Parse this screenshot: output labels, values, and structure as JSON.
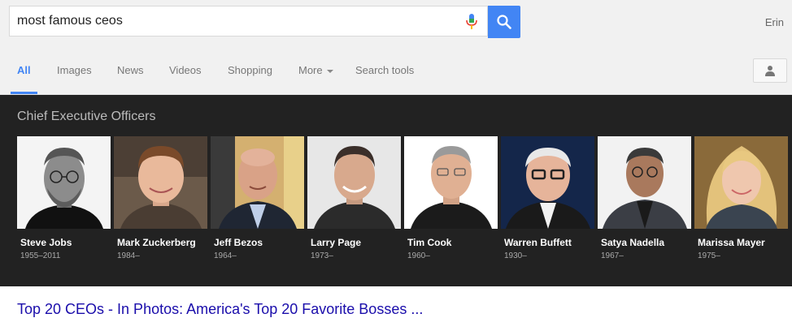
{
  "search": {
    "query": "most famous ceos"
  },
  "user": {
    "name": "Erin"
  },
  "tabs": [
    {
      "label": "All"
    },
    {
      "label": "Images"
    },
    {
      "label": "News"
    },
    {
      "label": "Videos"
    },
    {
      "label": "Shopping"
    },
    {
      "label": "More"
    },
    {
      "label": "Search tools"
    }
  ],
  "panel": {
    "title": "Chief Executive Officers",
    "people": [
      {
        "name": "Steve Jobs",
        "years": "1955–2011"
      },
      {
        "name": "Mark Zuckerberg",
        "years": "1984–"
      },
      {
        "name": "Jeff Bezos",
        "years": "1964–"
      },
      {
        "name": "Larry Page",
        "years": "1973–"
      },
      {
        "name": "Tim Cook",
        "years": "1960–"
      },
      {
        "name": "Warren Buffett",
        "years": "1930–"
      },
      {
        "name": "Satya Nadella",
        "years": "1967–"
      },
      {
        "name": "Marissa Mayer",
        "years": "1975–"
      }
    ]
  },
  "result": {
    "title": "Top 20 CEOs - In Photos: America's Top 20 Favorite Bosses ..."
  },
  "colors": {
    "accent": "#4285f4",
    "panel_bg": "#222222",
    "link": "#1a0dab"
  }
}
